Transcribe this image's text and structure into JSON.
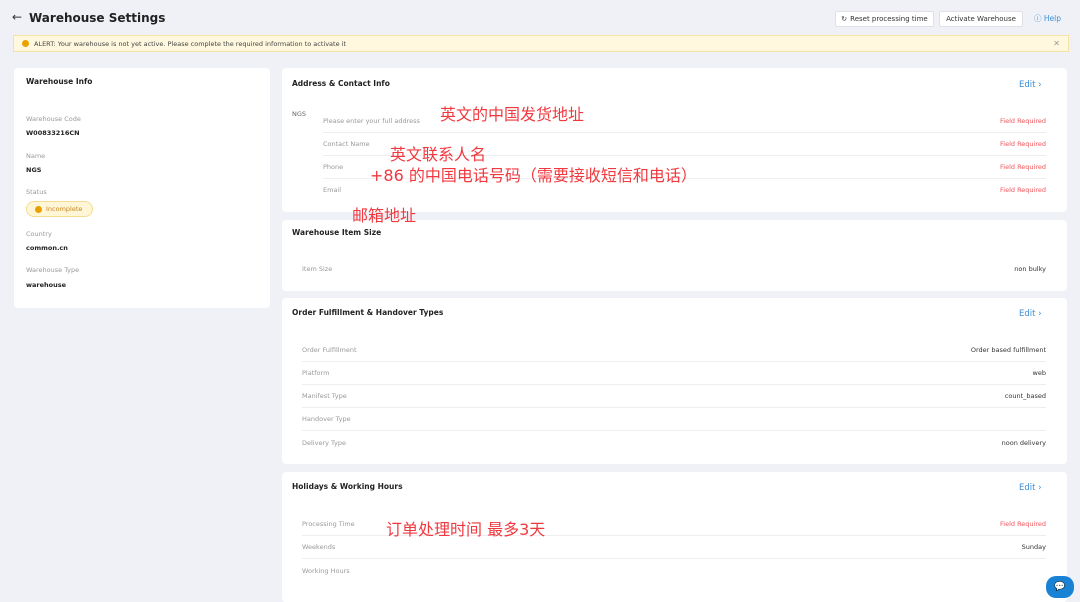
{
  "header": {
    "title": "Warehouse Settings",
    "reset_label": "Reset processing time",
    "activate_label": "Activate Warehouse",
    "help_label": "Help"
  },
  "alert": {
    "text": "ALERT: Your warehouse is not yet active. Please complete the required information to activate it"
  },
  "warehouse_info": {
    "title": "Warehouse Info",
    "fields": [
      {
        "label": "Warehouse Code",
        "value": "W00833216CN"
      },
      {
        "label": "Name",
        "value": "NGS"
      },
      {
        "label": "Status",
        "value": "Incomplete"
      },
      {
        "label": "Country",
        "value": "common.cn"
      },
      {
        "label": "Warehouse Type",
        "value": "warehouse"
      }
    ]
  },
  "address": {
    "title": "Address & Contact Info",
    "edit": "Edit",
    "img_alt": "NGS",
    "rows": [
      {
        "label": "Please enter your full address",
        "value": "Field Required"
      },
      {
        "label": "Contact Name",
        "value": "Field Required"
      },
      {
        "label": "Phone",
        "value": "Field Required"
      },
      {
        "label": "Email",
        "value": "Field Required"
      }
    ]
  },
  "item_size": {
    "title": "Warehouse Item Size",
    "rows": [
      {
        "label": "Item Size",
        "value": "non bulky"
      }
    ]
  },
  "fulfillment": {
    "title": "Order Fulfillment & Handover Types",
    "edit": "Edit",
    "rows": [
      {
        "label": "Order Fulfillment",
        "value": "Order based fulfillment"
      },
      {
        "label": "Platform",
        "value": "web"
      },
      {
        "label": "Manifest Type",
        "value": "count_based"
      },
      {
        "label": "Handover Type",
        "value": ""
      },
      {
        "label": "Delivery Type",
        "value": "noon delivery"
      }
    ]
  },
  "holidays": {
    "title": "Holidays & Working Hours",
    "edit": "Edit",
    "rows": [
      {
        "label": "Processing Time",
        "value": "Field Required"
      },
      {
        "label": "Weekends",
        "value": "Sunday"
      },
      {
        "label": "Working Hours",
        "value": ""
      }
    ]
  },
  "annotations": [
    "英文的中国发货地址",
    "英文联系人名",
    "+86 的中国电话号码（需要接收短信和电话）",
    "邮箱地址",
    "订单处理时间 最多3天"
  ]
}
